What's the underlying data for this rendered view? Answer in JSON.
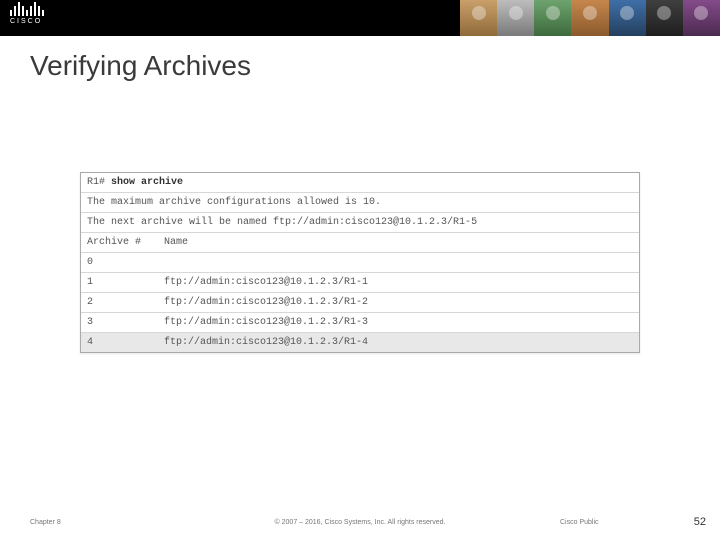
{
  "header": {
    "logo_text": "CISCO",
    "title": "Verifying Archives"
  },
  "terminal": {
    "prompt_host": "R1#",
    "prompt_cmd": "show archive",
    "msg_max": "The maximum archive configurations allowed is 10.",
    "msg_next": "The next archive will be named ftp://admin:cisco123@10.1.2.3/R1-5",
    "hdr_num": "Archive #",
    "hdr_name": "Name",
    "rows": {
      "r0_num": "0",
      "r0_name": "",
      "r1_num": "1",
      "r1_name": "ftp://admin:cisco123@10.1.2.3/R1-1",
      "r2_num": "2",
      "r2_name": "ftp://admin:cisco123@10.1.2.3/R1-2",
      "r3_num": "3",
      "r3_name": "ftp://admin:cisco123@10.1.2.3/R1-3",
      "r4_num": "4",
      "r4_name": "ftp://admin:cisco123@10.1.2.3/R1-4"
    }
  },
  "footer": {
    "chapter": "Chapter 8",
    "copyright": "© 2007 – 2016, Cisco Systems, Inc. All rights reserved.",
    "access": "Cisco Public",
    "slidenum": "52"
  }
}
